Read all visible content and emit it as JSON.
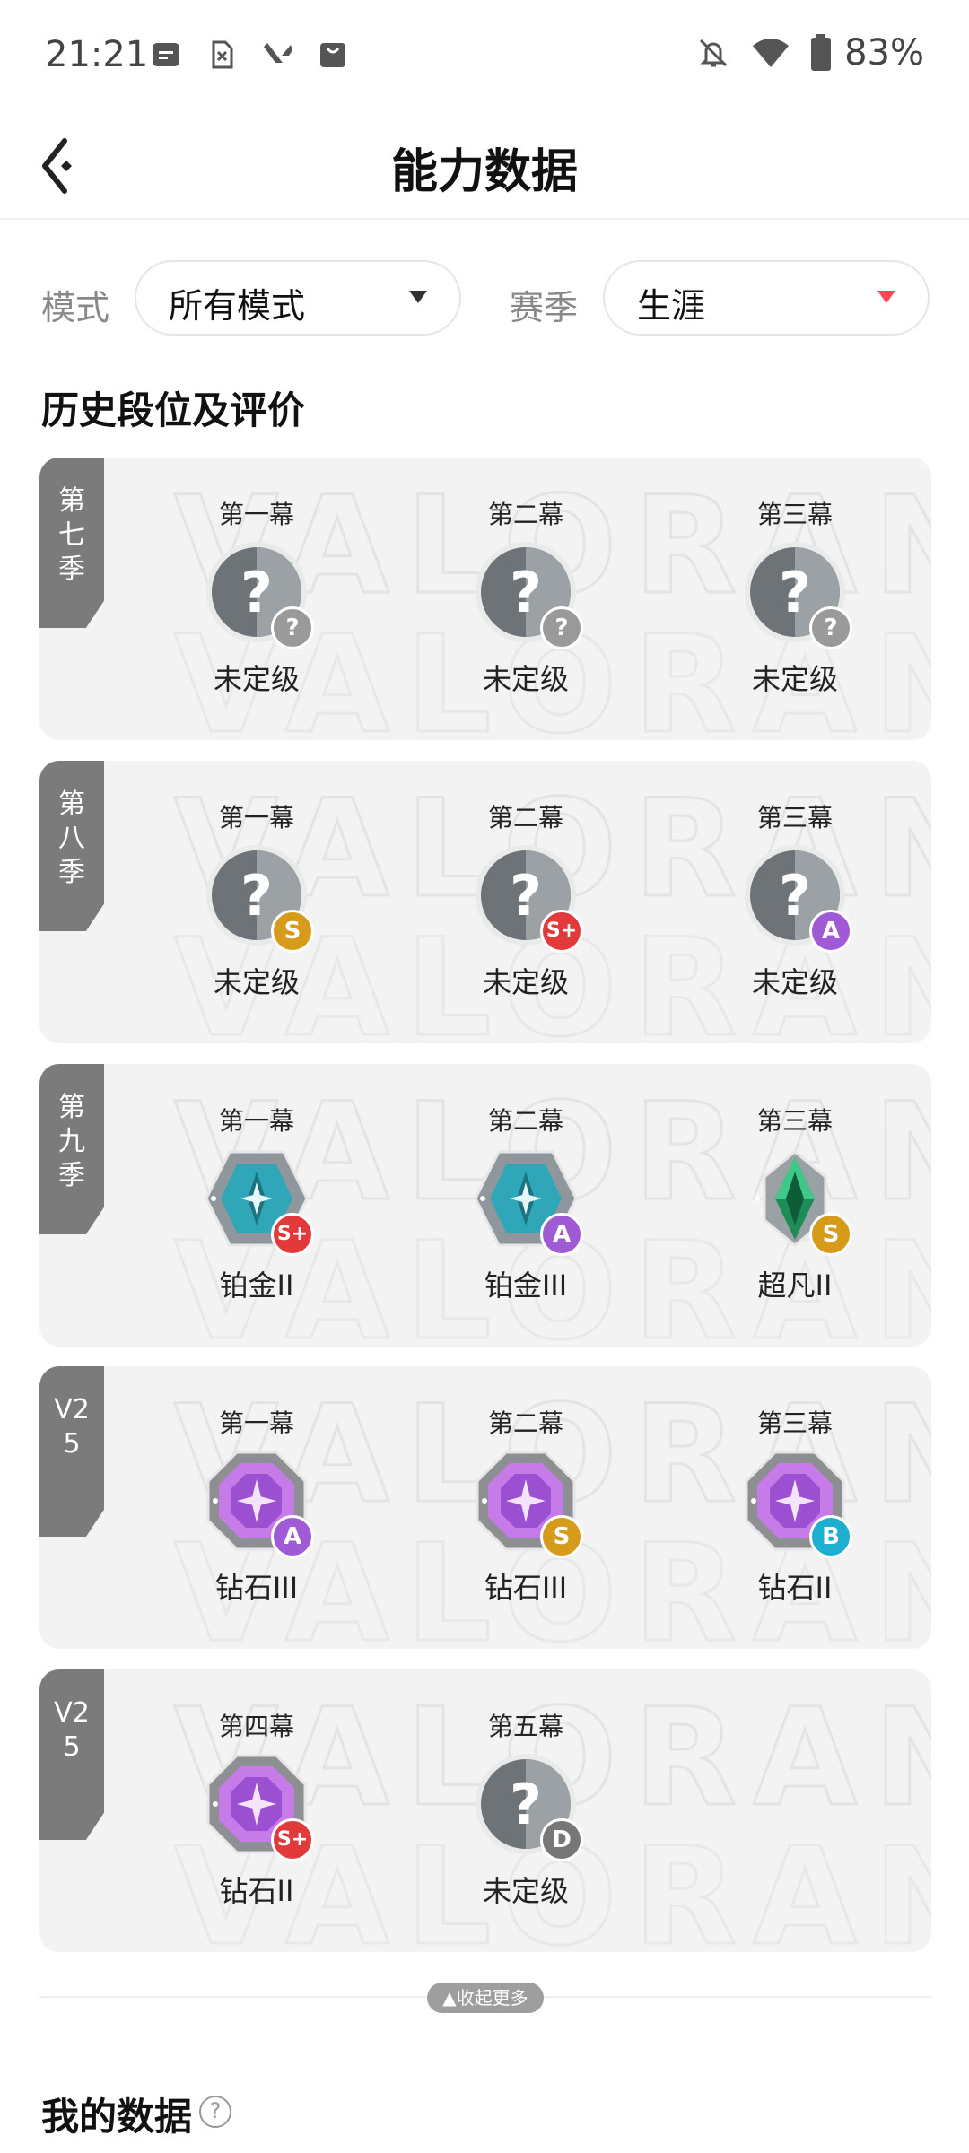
{
  "status_bar": {
    "time": "21:21",
    "battery": "83%"
  },
  "app_bar": {
    "title": "能力数据"
  },
  "filters": {
    "mode_label": "模式",
    "mode_value": "所有模式",
    "season_label": "赛季",
    "season_value": "生涯"
  },
  "section_title": "历史段位及评价",
  "grade_colors": {
    "S": "#d79b1b",
    "S+": "#e23a3a",
    "A": "#a05ad6",
    "B": "#1eaed0",
    "D": "#777777",
    "?": "#9a9a9a"
  },
  "cards": [
    {
      "tag": [
        "第",
        "七",
        "季"
      ],
      "acts": [
        {
          "name": "第一幕",
          "rank": "未定级",
          "emblem": "unranked",
          "grade": "?"
        },
        {
          "name": "第二幕",
          "rank": "未定级",
          "emblem": "unranked",
          "grade": "?"
        },
        {
          "name": "第三幕",
          "rank": "未定级",
          "emblem": "unranked",
          "grade": "?"
        }
      ]
    },
    {
      "tag": [
        "第",
        "八",
        "季"
      ],
      "acts": [
        {
          "name": "第一幕",
          "rank": "未定级",
          "emblem": "unranked",
          "grade": "S"
        },
        {
          "name": "第二幕",
          "rank": "未定级",
          "emblem": "unranked",
          "grade": "S+"
        },
        {
          "name": "第三幕",
          "rank": "未定级",
          "emblem": "unranked",
          "grade": "A"
        }
      ]
    },
    {
      "tag": [
        "第",
        "九",
        "季"
      ],
      "acts": [
        {
          "name": "第一幕",
          "rank": "铂金II",
          "emblem": "platinum",
          "grade": "S+"
        },
        {
          "name": "第二幕",
          "rank": "铂金III",
          "emblem": "platinum",
          "grade": "A"
        },
        {
          "name": "第三幕",
          "rank": "超凡II",
          "emblem": "ascendant",
          "grade": "S"
        }
      ]
    },
    {
      "tag": [
        "V2",
        "5"
      ],
      "acts": [
        {
          "name": "第一幕",
          "rank": "钻石III",
          "emblem": "diamond",
          "grade": "A"
        },
        {
          "name": "第二幕",
          "rank": "钻石III",
          "emblem": "diamond",
          "grade": "S"
        },
        {
          "name": "第三幕",
          "rank": "钻石II",
          "emblem": "diamond",
          "grade": "B"
        }
      ]
    },
    {
      "tag": [
        "V2",
        "5"
      ],
      "acts": [
        {
          "name": "第四幕",
          "rank": "钻石II",
          "emblem": "diamond",
          "grade": "S+"
        },
        {
          "name": "第五幕",
          "rank": "未定级",
          "emblem": "unranked",
          "grade": "D"
        }
      ]
    }
  ],
  "collapse_label": "▲收起更多",
  "my_data_title": "我的数据",
  "watermark_text": "VALORANT"
}
